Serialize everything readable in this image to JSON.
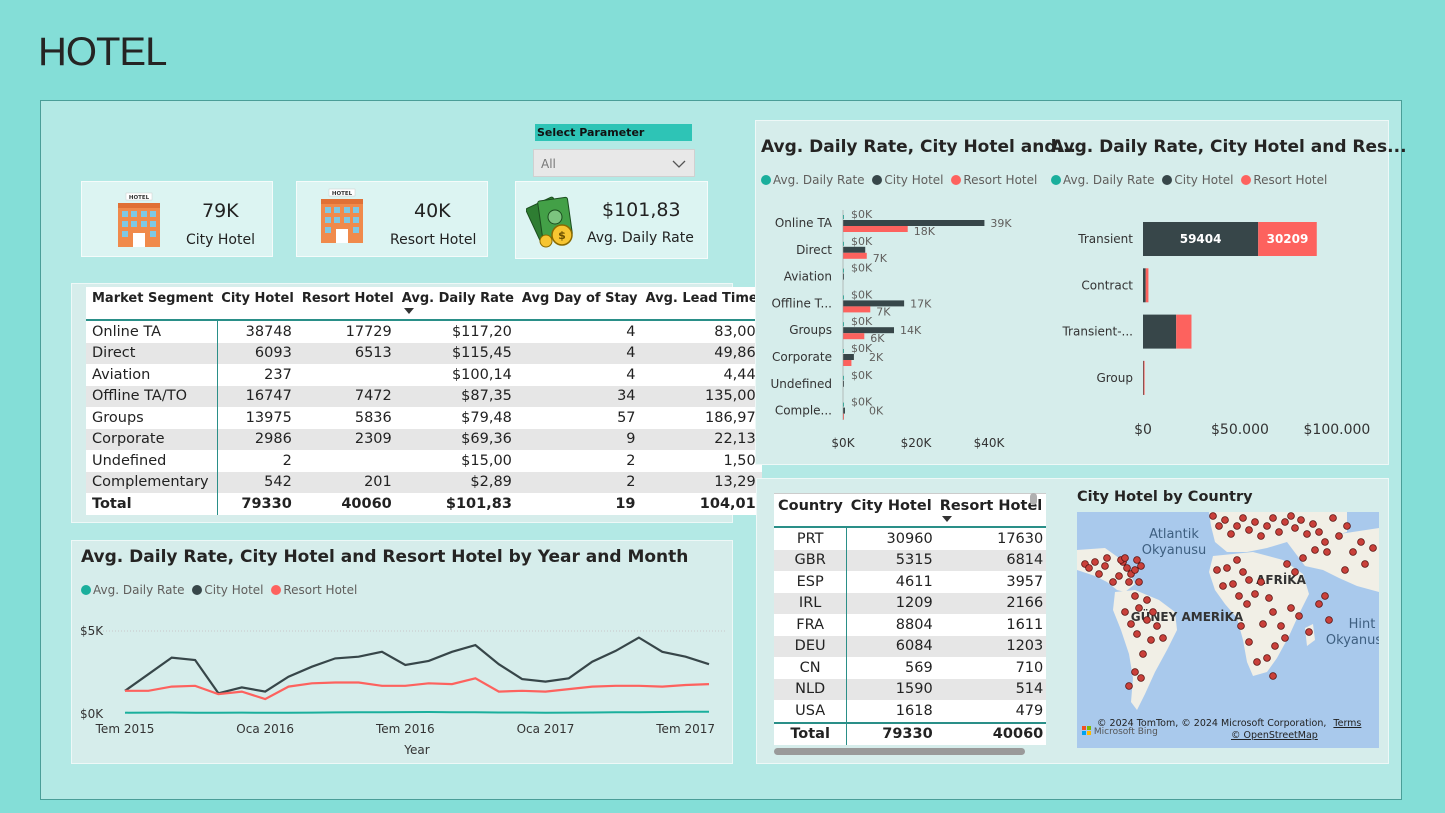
{
  "page": {
    "title": "HOTEL"
  },
  "filter": {
    "label": "Select Parameter",
    "selected": "All"
  },
  "kpis": [
    {
      "value": "79K",
      "label": "City Hotel",
      "icon": "hotel-icon"
    },
    {
      "value": "40K",
      "label": "Resort Hotel",
      "icon": "hotel-icon"
    },
    {
      "value": "$101,83",
      "label": "Avg. Daily Rate",
      "icon": "money-icon"
    }
  ],
  "colors": {
    "adr": "#1aaf9c",
    "city": "#374649",
    "resort": "#fd625e"
  },
  "segment_table": {
    "headers": [
      "Market Segment",
      "City Hotel",
      "Resort Hotel",
      "Avg. Daily Rate",
      "Avg Day of Stay",
      "Avg. Lead Time"
    ],
    "rows": [
      [
        "Online TA",
        "38748",
        "17729",
        "$117,20",
        "4",
        "83,00"
      ],
      [
        "Direct",
        "6093",
        "6513",
        "$115,45",
        "4",
        "49,86"
      ],
      [
        "Aviation",
        "237",
        "",
        "$100,14",
        "4",
        "4,44"
      ],
      [
        "Offline TA/TO",
        "16747",
        "7472",
        "$87,35",
        "34",
        "135,00"
      ],
      [
        "Groups",
        "13975",
        "5836",
        "$79,48",
        "57",
        "186,97"
      ],
      [
        "Corporate",
        "2986",
        "2309",
        "$69,36",
        "9",
        "22,13"
      ],
      [
        "Undefined",
        "2",
        "",
        "$15,00",
        "2",
        "1,50"
      ],
      [
        "Complementary",
        "542",
        "201",
        "$2,89",
        "2",
        "13,29"
      ]
    ],
    "total": [
      "Total",
      "79330",
      "40060",
      "$101,83",
      "19",
      "104,01"
    ]
  },
  "country_table": {
    "headers": [
      "Country",
      "City Hotel",
      "Resort Hotel"
    ],
    "rows": [
      [
        "PRT",
        "30960",
        "17630"
      ],
      [
        "GBR",
        "5315",
        "6814"
      ],
      [
        "ESP",
        "4611",
        "3957"
      ],
      [
        "IRL",
        "1209",
        "2166"
      ],
      [
        "FRA",
        "8804",
        "1611"
      ],
      [
        "DEU",
        "6084",
        "1203"
      ],
      [
        "CN",
        "569",
        "710"
      ],
      [
        "NLD",
        "1590",
        "514"
      ],
      [
        "USA",
        "1618",
        "479"
      ]
    ],
    "total": [
      "Total",
      "79330",
      "40060"
    ]
  },
  "legend": {
    "adr": "Avg. Daily Rate",
    "city": "City Hotel",
    "resort": "Resort Hotel"
  },
  "chart_data": [
    {
      "id": "segment-bar",
      "type": "bar",
      "title": "Avg. Daily Rate, City Hotel and...",
      "orientation": "horizontal",
      "categories": [
        "Online TA",
        "Direct",
        "Aviation",
        "Offline T...",
        "Groups",
        "Corporate",
        "Undefined",
        "Comple..."
      ],
      "series": [
        {
          "name": "Avg. Daily Rate",
          "values": [
            117.2,
            115.45,
            100.14,
            87.35,
            79.48,
            69.36,
            15,
            2.89
          ],
          "labels": [
            "$0K",
            "$0K",
            "$0K",
            "$0K",
            "$0K",
            "$0K",
            "$0K",
            "$0K"
          ]
        },
        {
          "name": "City Hotel",
          "values": [
            38748,
            6093,
            237,
            16747,
            13975,
            2986,
            2,
            542
          ],
          "labels": [
            "39K",
            "",
            "",
            "17K",
            "14K",
            "2K",
            "",
            "0K"
          ]
        },
        {
          "name": "Resort Hotel",
          "values": [
            17729,
            6513,
            0,
            7472,
            5836,
            2309,
            0,
            201
          ],
          "labels": [
            "18K",
            "7K",
            "",
            "7K",
            "6K",
            "",
            "",
            ""
          ]
        }
      ],
      "xticks": [
        "$0K",
        "$20K",
        "$40K"
      ],
      "xlim": [
        0,
        40000
      ]
    },
    {
      "id": "customer-type-bar",
      "type": "bar",
      "title": "Avg. Daily Rate, City Hotel and Res...",
      "orientation": "horizontal",
      "stacked": true,
      "categories": [
        "Transient",
        "Contract",
        "Transient-...",
        "Group"
      ],
      "series": [
        {
          "name": "Avg. Daily Rate",
          "values": [
            0,
            0,
            0,
            0
          ]
        },
        {
          "name": "City Hotel",
          "values": [
            59404,
            1400,
            17100,
            300
          ]
        },
        {
          "name": "Resort Hotel",
          "values": [
            30209,
            1400,
            7900,
            100
          ]
        }
      ],
      "data_labels": [
        "59404",
        "30209"
      ],
      "xticks": [
        "$0",
        "$50.000",
        "$100.000"
      ],
      "xlim": [
        0,
        115000
      ]
    },
    {
      "id": "monthly-line",
      "type": "line",
      "title": "Avg. Daily Rate, City Hotel and Resort Hotel by Year and Month",
      "xlabel": "Year",
      "x": [
        "2015-07",
        "2015-08",
        "2015-09",
        "2015-10",
        "2015-11",
        "2015-12",
        "2016-01",
        "2016-02",
        "2016-03",
        "2016-04",
        "2016-05",
        "2016-06",
        "2016-07",
        "2016-08",
        "2016-09",
        "2016-10",
        "2016-11",
        "2016-12",
        "2017-01",
        "2017-02",
        "2017-03",
        "2017-04",
        "2017-05",
        "2017-06",
        "2017-07",
        "2017-08"
      ],
      "xticks": [
        "Tem 2015",
        "Oca 2016",
        "Tem 2016",
        "Oca 2017",
        "Tem 2017"
      ],
      "yticks": [
        "$0K",
        "$5K"
      ],
      "ylim": [
        0,
        5000
      ],
      "series": [
        {
          "name": "Avg. Daily Rate",
          "values": [
            80,
            85,
            90,
            80,
            75,
            85,
            70,
            75,
            85,
            95,
            100,
            110,
            115,
            120,
            110,
            100,
            90,
            90,
            80,
            85,
            90,
            100,
            110,
            120,
            130,
            135
          ]
        },
        {
          "name": "City Hotel",
          "values": [
            1400,
            2400,
            3400,
            3250,
            1250,
            1600,
            1350,
            2250,
            2850,
            3350,
            3450,
            3750,
            2950,
            3200,
            3750,
            4150,
            3000,
            2100,
            1950,
            2150,
            3150,
            3800,
            4600,
            3750,
            3450,
            3000
          ]
        },
        {
          "name": "Resort Hotel",
          "values": [
            1400,
            1400,
            1650,
            1700,
            1200,
            1350,
            900,
            1650,
            1850,
            1900,
            1900,
            1700,
            1700,
            1850,
            1800,
            2150,
            1350,
            1400,
            1350,
            1500,
            1650,
            1700,
            1700,
            1650,
            1750,
            1800
          ]
        }
      ]
    }
  ],
  "map": {
    "title": "City Hotel by Country",
    "labels": [
      "Atlantik",
      "Okyanusu",
      "AFRİKA",
      "GÜNEY AMERİKA",
      "Hint",
      "Okyanus"
    ],
    "attribution": "© 2024 TomTom, © 2024 Microsoft Corporation,",
    "terms": "Terms",
    "osm": "© OpenStreetMap",
    "brand": "Microsoft Bing"
  }
}
